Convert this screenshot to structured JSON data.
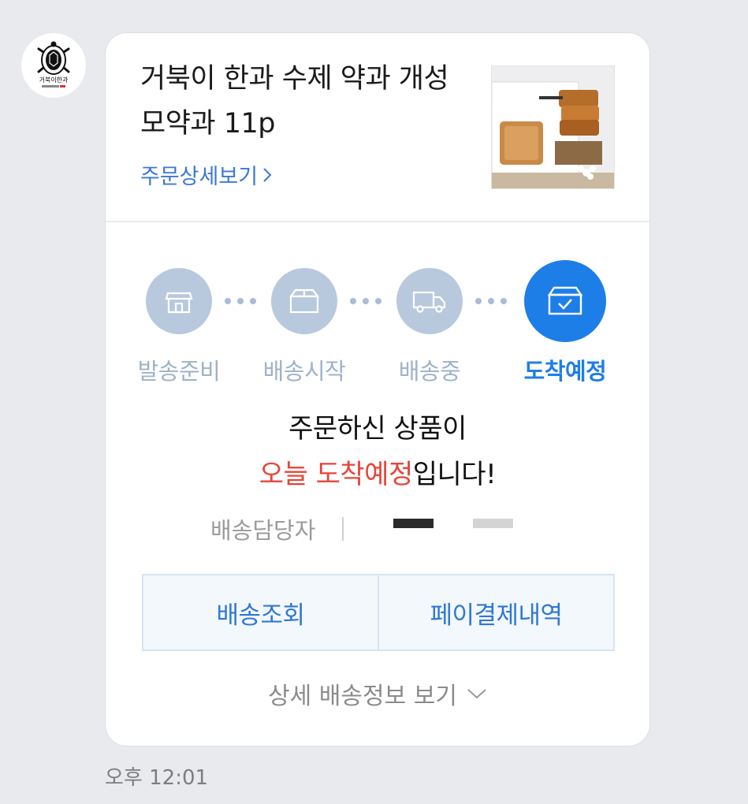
{
  "sender": {
    "avatar_logo_text": "거북이한과"
  },
  "product": {
    "title": "거북이 한과 수제 약과 개성모약과 11p",
    "order_detail_link": "주문상세보기"
  },
  "delivery_steps": [
    {
      "label": "발송준비",
      "icon": "store-icon",
      "active": false
    },
    {
      "label": "배송시작",
      "icon": "box-icon",
      "active": false
    },
    {
      "label": "배송중",
      "icon": "truck-icon",
      "active": false
    },
    {
      "label": "도착예정",
      "icon": "box-check-icon",
      "active": true
    }
  ],
  "message": {
    "line1": "주문하신 상품이",
    "highlight": "오늘 도착예정",
    "suffix": "입니다!"
  },
  "courier": {
    "label": "배송담당자"
  },
  "actions": {
    "track": "배송조회",
    "pay_history": "페이결제내역"
  },
  "more_info": "상세 배송정보 보기",
  "timestamp": "오후 12:01",
  "colors": {
    "accent": "#1e7ee8",
    "inactive_step": "#b8c9dd",
    "highlight_red": "#e5463a",
    "button_text": "#2f78d4"
  }
}
